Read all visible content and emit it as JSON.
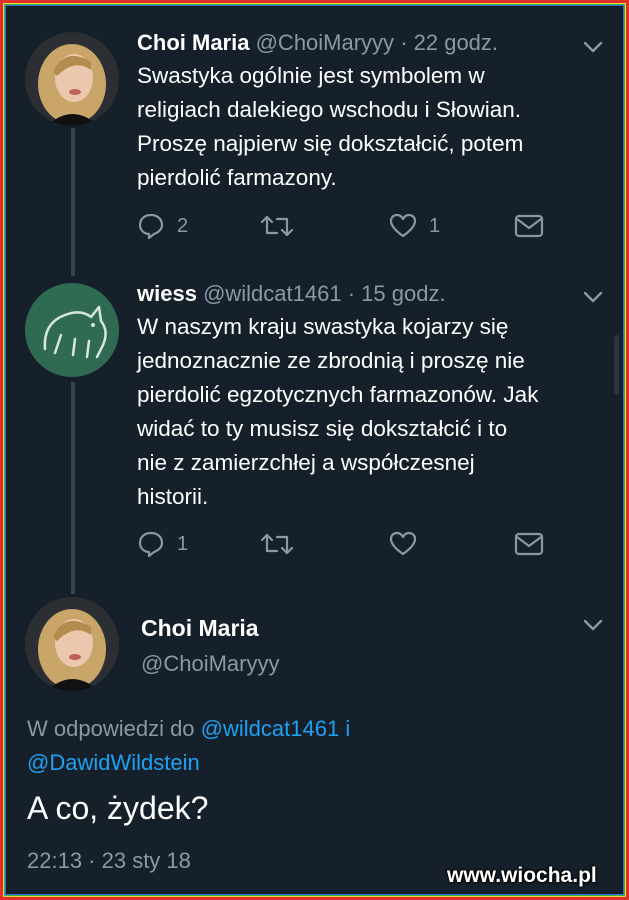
{
  "tweets": [
    {
      "name": "Choi Maria",
      "handle": "@ChoiMaryyy",
      "time": "· 22 godz.",
      "text_lines": [
        "Swastyka ogólnie jest symbolem w",
        "religiach dalekiego wschodu i Słowian.",
        "Proszę najpierw się dokształcić, potem",
        "pierdolić farmazony."
      ],
      "replies": "2",
      "retweets": "",
      "likes": "1"
    },
    {
      "name": "wiess",
      "handle": "@wildcat1461",
      "time": "· 15 godz.",
      "text_lines": [
        "W naszym kraju swastyka kojarzy się",
        "jednoznacznie ze zbrodnią i proszę nie",
        "pierdolić egzotycznych farmazonów. Jak",
        "widać to ty musisz się dokształcić i to",
        "nie z zamierzchłej a współczesnej",
        "historii."
      ],
      "replies": "1",
      "retweets": "",
      "likes": ""
    }
  ],
  "focused": {
    "name": "Choi Maria",
    "handle": "@ChoiMaryyy",
    "reply_prefix": "W odpowiedzi do",
    "reply_user1": "@wildcat1461",
    "reply_joiner": "i",
    "reply_user2": "@DawidWildstein",
    "text": "A co, żydek?",
    "timestamp": "22:13 · 23 sty 18"
  },
  "watermark": "www.wiocha.pl",
  "colors": {
    "background": "#15202b",
    "secondary_text": "#8899a6",
    "link": "#1da1f2"
  }
}
